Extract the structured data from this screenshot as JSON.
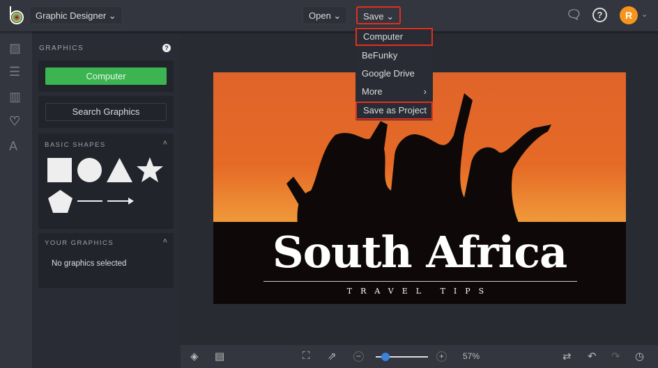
{
  "header": {
    "app_label": "Graphic Designer",
    "open_label": "Open",
    "save_label": "Save",
    "avatar_initial": "R"
  },
  "save_menu": {
    "items": [
      "Computer",
      "BeFunky",
      "Google Drive",
      "More",
      "Save as Project"
    ]
  },
  "panel": {
    "title": "GRAPHICS",
    "computer_button": "Computer",
    "search_button": "Search Graphics",
    "basic_shapes": "BASIC SHAPES",
    "your_graphics": "YOUR GRAPHICS",
    "no_graphics": "No graphics selected"
  },
  "image": {
    "title": "South Africa",
    "subtitle": "TRAVEL TIPS"
  },
  "toolbar": {
    "zoom_label": "57%",
    "zoom_fraction": 0.1
  },
  "colors": {
    "accent_green": "#3cb451",
    "highlight_red": "#e0301e",
    "avatar": "#f7941d",
    "slider": "#3b82e0"
  }
}
